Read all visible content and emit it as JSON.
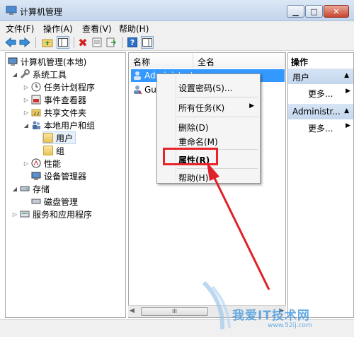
{
  "window": {
    "title": "计算机管理"
  },
  "menu": [
    "文件(F)",
    "操作(A)",
    "查看(V)",
    "帮助(H)"
  ],
  "tree": [
    {
      "label": "计算机管理(本地)"
    },
    {
      "label": "系统工具"
    },
    {
      "label": "任务计划程序"
    },
    {
      "label": "事件查看器"
    },
    {
      "label": "共享文件夹"
    },
    {
      "label": "本地用户和组"
    },
    {
      "label": "用户"
    },
    {
      "label": "组"
    },
    {
      "label": "性能"
    },
    {
      "label": "设备管理器"
    },
    {
      "label": "存储"
    },
    {
      "label": "磁盘管理"
    },
    {
      "label": "服务和应用程序"
    }
  ],
  "list": {
    "columns": [
      "名称",
      "全名"
    ],
    "rows": [
      "Administrat",
      "Gue"
    ]
  },
  "context_menu": {
    "items": [
      "设置密码(S)...",
      "所有任务(K)",
      "删除(D)",
      "重命名(M)",
      "属性(R)",
      "帮助(H)"
    ]
  },
  "actions": {
    "title": "操作",
    "sections": [
      {
        "title": "用户",
        "more": "更多..."
      },
      {
        "title": "Administr...",
        "more": "更多..."
      }
    ]
  },
  "scrollbar": {
    "grip": "III"
  },
  "watermark": {
    "text": "我爱IT技术网",
    "url": "www.52ij.com"
  },
  "colors": {
    "highlight_box": "#e8242b",
    "arrow": "#e0202a",
    "selection": "#3399ff"
  }
}
